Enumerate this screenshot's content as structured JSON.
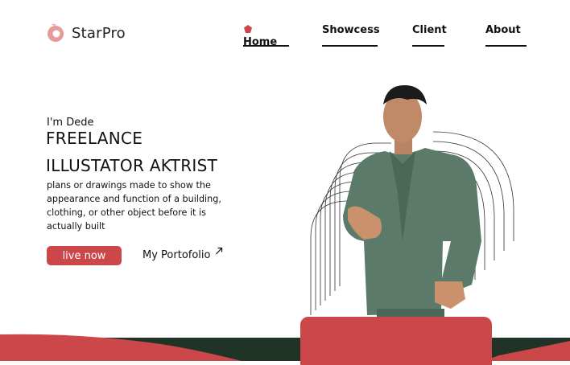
{
  "brand": {
    "name": "StarPro",
    "logo_icon": "donut-logo-icon"
  },
  "nav": {
    "items": [
      {
        "label": "Home",
        "icon": "pentagon-gem-icon",
        "active": true
      },
      {
        "label": "Showcess"
      },
      {
        "label": "Client"
      },
      {
        "label": "About"
      }
    ]
  },
  "hero": {
    "greeting": "I'm Dede",
    "title_line1": "FREELANCE",
    "title_line2": "ILLUSTATOR AKTRIST",
    "description": "plans or drawings made to show the appearance and function of a building, clothing, or other object before it is actually built",
    "primary_button": "live now",
    "secondary_link": "My Portofolio",
    "secondary_link_icon": "arrow-up-right-icon"
  },
  "colors": {
    "accent": "#cc474a",
    "dark_band": "#1f3327",
    "text": "#111111",
    "logo_pink": "#e79a97"
  }
}
